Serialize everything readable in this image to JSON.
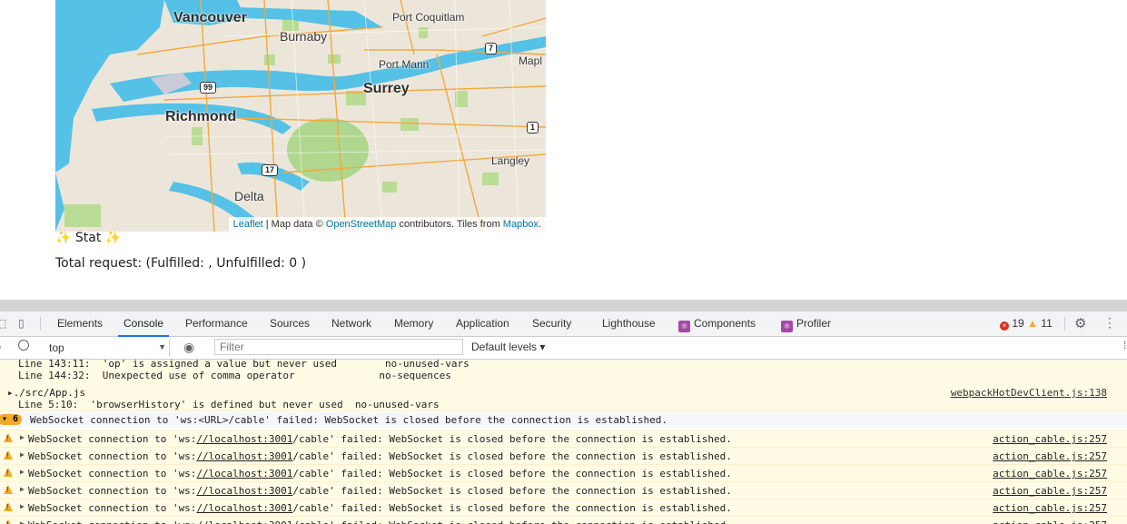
{
  "map": {
    "labels": {
      "vancouver": "Vancouver",
      "burnaby": "Burnaby",
      "port_coquitlam": "Port Coquitlam",
      "port_mann": "Port Mann",
      "maple": "Mapl",
      "surrey": "Surrey",
      "richmond": "Richmond",
      "langley": "Langley",
      "delta": "Delta"
    },
    "shields": {
      "hw99": "99",
      "hw7": "7",
      "hw1": "1",
      "hw17": "17"
    },
    "attribution": {
      "leaflet": "Leaflet",
      "sep": " | Map data © ",
      "osm": "OpenStreetMap",
      "contrib": " contributors. Tiles from ",
      "mapbox": "Mapbox",
      "end": "."
    },
    "colors": {
      "land": "#ece6da",
      "water": "#55c1e6",
      "park": "#b4dc8c",
      "road": "#f3a83b"
    }
  },
  "stats": {
    "title": "✨ Stat ✨",
    "total_line": "Total request: (Fulfilled: , Unfulfilled: 0 )"
  },
  "devtools": {
    "tabs": [
      "Elements",
      "Console",
      "Performance",
      "Sources",
      "Network",
      "Memory",
      "Application",
      "Security",
      "Lighthouse",
      "Components",
      "Profiler"
    ],
    "active_tab": "Console",
    "error_count": "19",
    "warning_count": "11",
    "context": "top",
    "filter_placeholder": "Filter",
    "levels": "Default levels ▾",
    "console": {
      "line1": "Line 143:11:  'op' is assigned a value but never used        no-unused-vars",
      "line2": "Line 144:32:  Unexpected use of comma operator              no-sequences",
      "file": "▸./src/App.js",
      "line3": "Line 5:10:  'browserHistory' is defined but never used  no-unused-vars",
      "file_link": "webpackHotDevClient.js:138",
      "group_count": "6",
      "group_msg": "WebSocket connection to 'ws:<URL>/cable' failed: WebSocket is closed before the connection is established.",
      "row_pre": "WebSocket connection to 'ws:",
      "row_url": "//localhost:3001",
      "row_post": "/cable' failed: WebSocket is closed before the connection is established.",
      "row_src": "action_cable.js:257"
    }
  }
}
